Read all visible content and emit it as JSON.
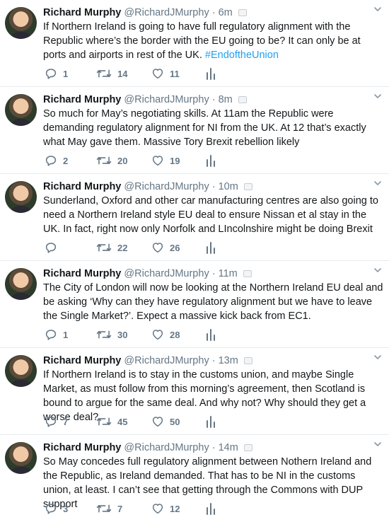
{
  "tweets": [
    {
      "name": "Richard Murphy",
      "handle": "@RichardJMurphy",
      "dot": "·",
      "time": "6m",
      "text": "If Northern Ireland is going to have full regulatory alignment with the Republic where’s the border with the EU going to be? It can only be at ports and airports in rest of the UK. ",
      "hashtag": "#EndoftheUnion",
      "replies": "1",
      "retweets": "14",
      "likes": "11"
    },
    {
      "name": "Richard Murphy",
      "handle": "@RichardJMurphy",
      "dot": "·",
      "time": "8m",
      "text": "So much for May’s negotiating skills. At 11am the Republic were demanding regulatory alignment for NI from the UK. At 12 that’s exactly what May gave them. Massive Tory Brexit rebellion likely",
      "hashtag": "",
      "replies": "2",
      "retweets": "20",
      "likes": "19"
    },
    {
      "name": "Richard Murphy",
      "handle": "@RichardJMurphy",
      "dot": "·",
      "time": "10m",
      "text": "Sunderland, Oxford and other car manufacturing centres are also going to need a Northern Ireland style EU deal to ensure Nissan et al stay in the UK. In fact, right now only Norfolk and LIncolnshire might be doing Brexit",
      "hashtag": "",
      "replies": "",
      "retweets": "22",
      "likes": "26"
    },
    {
      "name": "Richard Murphy",
      "handle": "@RichardJMurphy",
      "dot": "·",
      "time": "11m",
      "text": "The City of London will now be looking at the Northern  Ireland EU deal and be asking ‘Why can they have regulatory alignment but we have to leave the Single Market?’. Expect a massive kick back from EC1.",
      "hashtag": "",
      "replies": "1",
      "retweets": "30",
      "likes": "28"
    },
    {
      "name": "Richard Murphy",
      "handle": "@RichardJMurphy",
      "dot": "·",
      "time": "13m",
      "text": "If Northern Ireland is to stay in the customs union, and maybe Single Market, as must follow from this morning’s agreement, then Scotland is bound to argue for the same deal. And why not? Why should they get a worse deal?",
      "hashtag": "",
      "replies": "7",
      "retweets": "45",
      "likes": "50"
    },
    {
      "name": "Richard Murphy",
      "handle": "@RichardJMurphy",
      "dot": "·",
      "time": "14m",
      "text": "So May concedes full regulatory alignment between Nothern Ireland and the Republic, as Ireland demanded. That has to be NI in the customs union, at least. I can’t see that getting through the Commons with DUP support",
      "hashtag": "",
      "replies": "3",
      "retweets": "7",
      "likes": "12"
    }
  ],
  "icons": {
    "reply": "reply-icon",
    "retweet": "retweet-icon",
    "like": "heart-icon",
    "stats": "analytics-icon",
    "caret": "chevron-down-icon"
  },
  "colors": {
    "text": "#14171a",
    "secondary": "#657786",
    "link": "#1da1f2",
    "divider": "#e6ecf0"
  }
}
